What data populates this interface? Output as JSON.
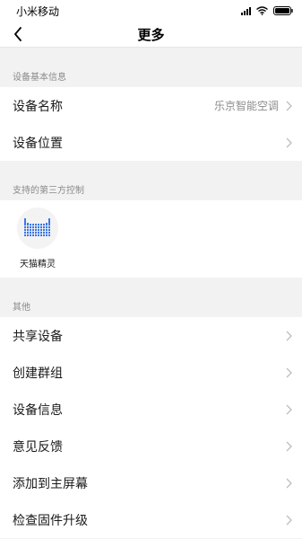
{
  "status_bar": {
    "carrier": "小米移动",
    "icons": [
      "signal-icon",
      "wifi-icon",
      "battery-icon"
    ]
  },
  "header": {
    "title": "更多",
    "back_icon": "chevron-left-icon"
  },
  "device_info": {
    "section_title": "设备基本信息",
    "rows": [
      {
        "label": "设备名称",
        "value": "乐京智能空调"
      },
      {
        "label": "设备位置",
        "value": ""
      }
    ]
  },
  "third_party": {
    "section_title": "支持的第三方控制",
    "items": [
      {
        "label": "天猫精灵",
        "icon": "tmall-genie-icon"
      }
    ]
  },
  "other": {
    "section_title": "其他",
    "rows": [
      {
        "label": "共享设备"
      },
      {
        "label": "创建群组"
      },
      {
        "label": "设备信息"
      },
      {
        "label": "意见反馈"
      },
      {
        "label": "添加到主屏幕"
      },
      {
        "label": "检查固件升级"
      }
    ]
  },
  "colors": {
    "background": "#f2f2f2",
    "surface": "#ffffff",
    "secondary_text": "#8c8c8c",
    "accent_icon": "#3b78e7"
  }
}
